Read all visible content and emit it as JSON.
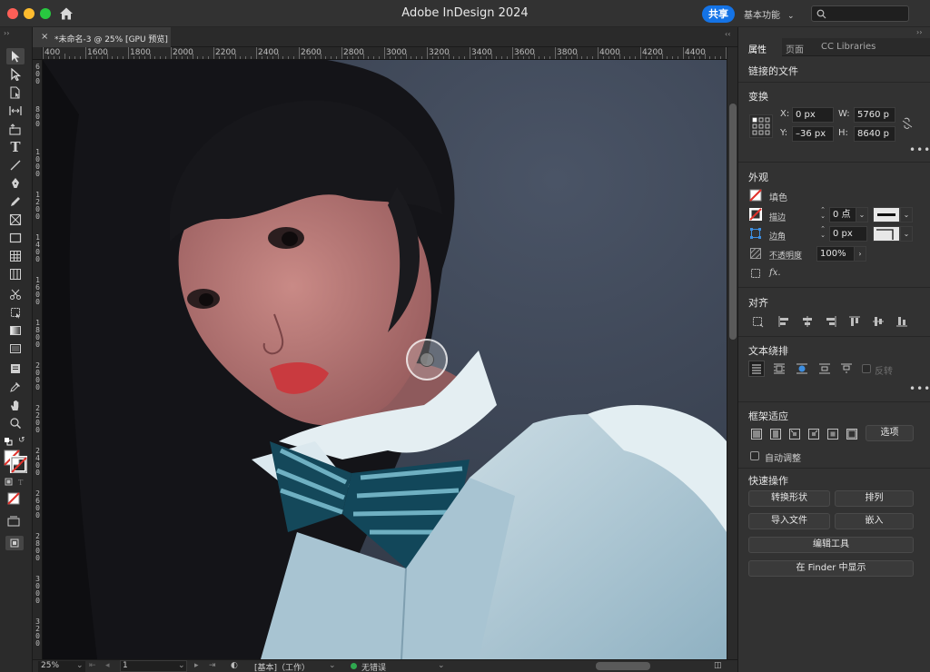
{
  "window": {
    "title": "Adobe InDesign 2024",
    "share_label": "共享",
    "workspace_label": "基本功能",
    "search_placeholder": ""
  },
  "document_tab": {
    "close_glyph": "×",
    "label": "*未命名-3 @ 25% [GPU 预览]"
  },
  "ruler": {
    "top_labels": [
      "400",
      "1600",
      "1800",
      "2000",
      "2200",
      "2400",
      "2600",
      "2800",
      "3000",
      "3200",
      "3400",
      "3600",
      "3800",
      "4000",
      "4200",
      "4400",
      "46"
    ],
    "left_labels": [
      "600",
      "800",
      "1000",
      "1200",
      "1400",
      "1600",
      "1800",
      "2000",
      "2200",
      "2400",
      "2600",
      "2800",
      "3000",
      "3200"
    ]
  },
  "status": {
    "zoom": "25%",
    "page": "1",
    "mode": "[基本]（工作）",
    "preflight": "无错误"
  },
  "panel": {
    "tabs": [
      "属性",
      "页面",
      "CC Libraries"
    ],
    "linked_file_title": "链接的文件",
    "transform": {
      "title": "变换",
      "x_label": "X:",
      "x_value": "0 px",
      "y_label": "Y:",
      "y_value": "–36 px",
      "w_label": "W:",
      "w_value": "5760 p",
      "h_label": "H:",
      "h_value": "8640 p"
    },
    "appearance": {
      "title": "外观",
      "fill_label": "填色",
      "stroke_label": "描边",
      "stroke_value": "0 点",
      "corner_label": "边角",
      "corner_value": "0 px",
      "opacity_label": "不透明度",
      "opacity_value": "100%",
      "fx_label": "fx."
    },
    "align": {
      "title": "对齐"
    },
    "text_wrap": {
      "title": "文本绕排",
      "invert_label": "反转"
    },
    "frame_fitting": {
      "title": "框架适应",
      "options_label": "选项",
      "auto_fit_label": "自动调整"
    },
    "quick_actions": {
      "title": "快速操作",
      "convert_shape": "转换形状",
      "arrange": "排列",
      "import_file": "导入文件",
      "embed": "嵌入",
      "edit_tools": "编辑工具",
      "show_in_finder": "在 Finder 中显示"
    }
  },
  "colors": {
    "accent": "#1473e6",
    "panel_bg": "#323232",
    "status_ok": "#2fa84f"
  }
}
